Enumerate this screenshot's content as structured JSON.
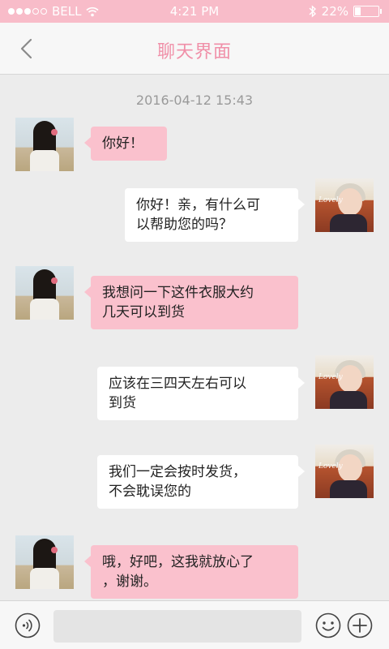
{
  "status_bar": {
    "carrier": "BELL",
    "time": "4:21 PM",
    "battery": "22%",
    "battery_level": 0.22,
    "signal_bars_filled": 3,
    "signal_bars_total": 5
  },
  "header": {
    "title": "聊天界面",
    "back_icon": "chevron-left-icon"
  },
  "chat": {
    "timestamp": "2016-04-12  15:43",
    "messages": [
      {
        "sender": "other",
        "text": "你好！"
      },
      {
        "sender": "self",
        "lines": [
          "你好！亲，有什么可",
          "以帮助您的吗？"
        ]
      },
      {
        "sender": "other",
        "lines": [
          "我想问一下这件衣服大约",
          "几天可以到货"
        ]
      },
      {
        "sender": "self",
        "lines": [
          "应该在三四天左右可以",
          "到货"
        ]
      },
      {
        "sender": "self",
        "lines": [
          "我们一定会按时发货，",
          "不会耽误您的"
        ]
      },
      {
        "sender": "other",
        "lines": [
          "哦，好吧，这我就放心了",
          "，谢谢。"
        ]
      }
    ]
  },
  "input_bar": {
    "value": "",
    "placeholder": "",
    "icons": [
      "voice-icon",
      "emoji-icon",
      "plus-icon"
    ]
  },
  "colors": {
    "accent": "#f08fa8",
    "status_bar": "#f8bcc9",
    "bubble_other": "#fac1cd",
    "bubble_self": "#ffffff",
    "background": "#ececec"
  }
}
